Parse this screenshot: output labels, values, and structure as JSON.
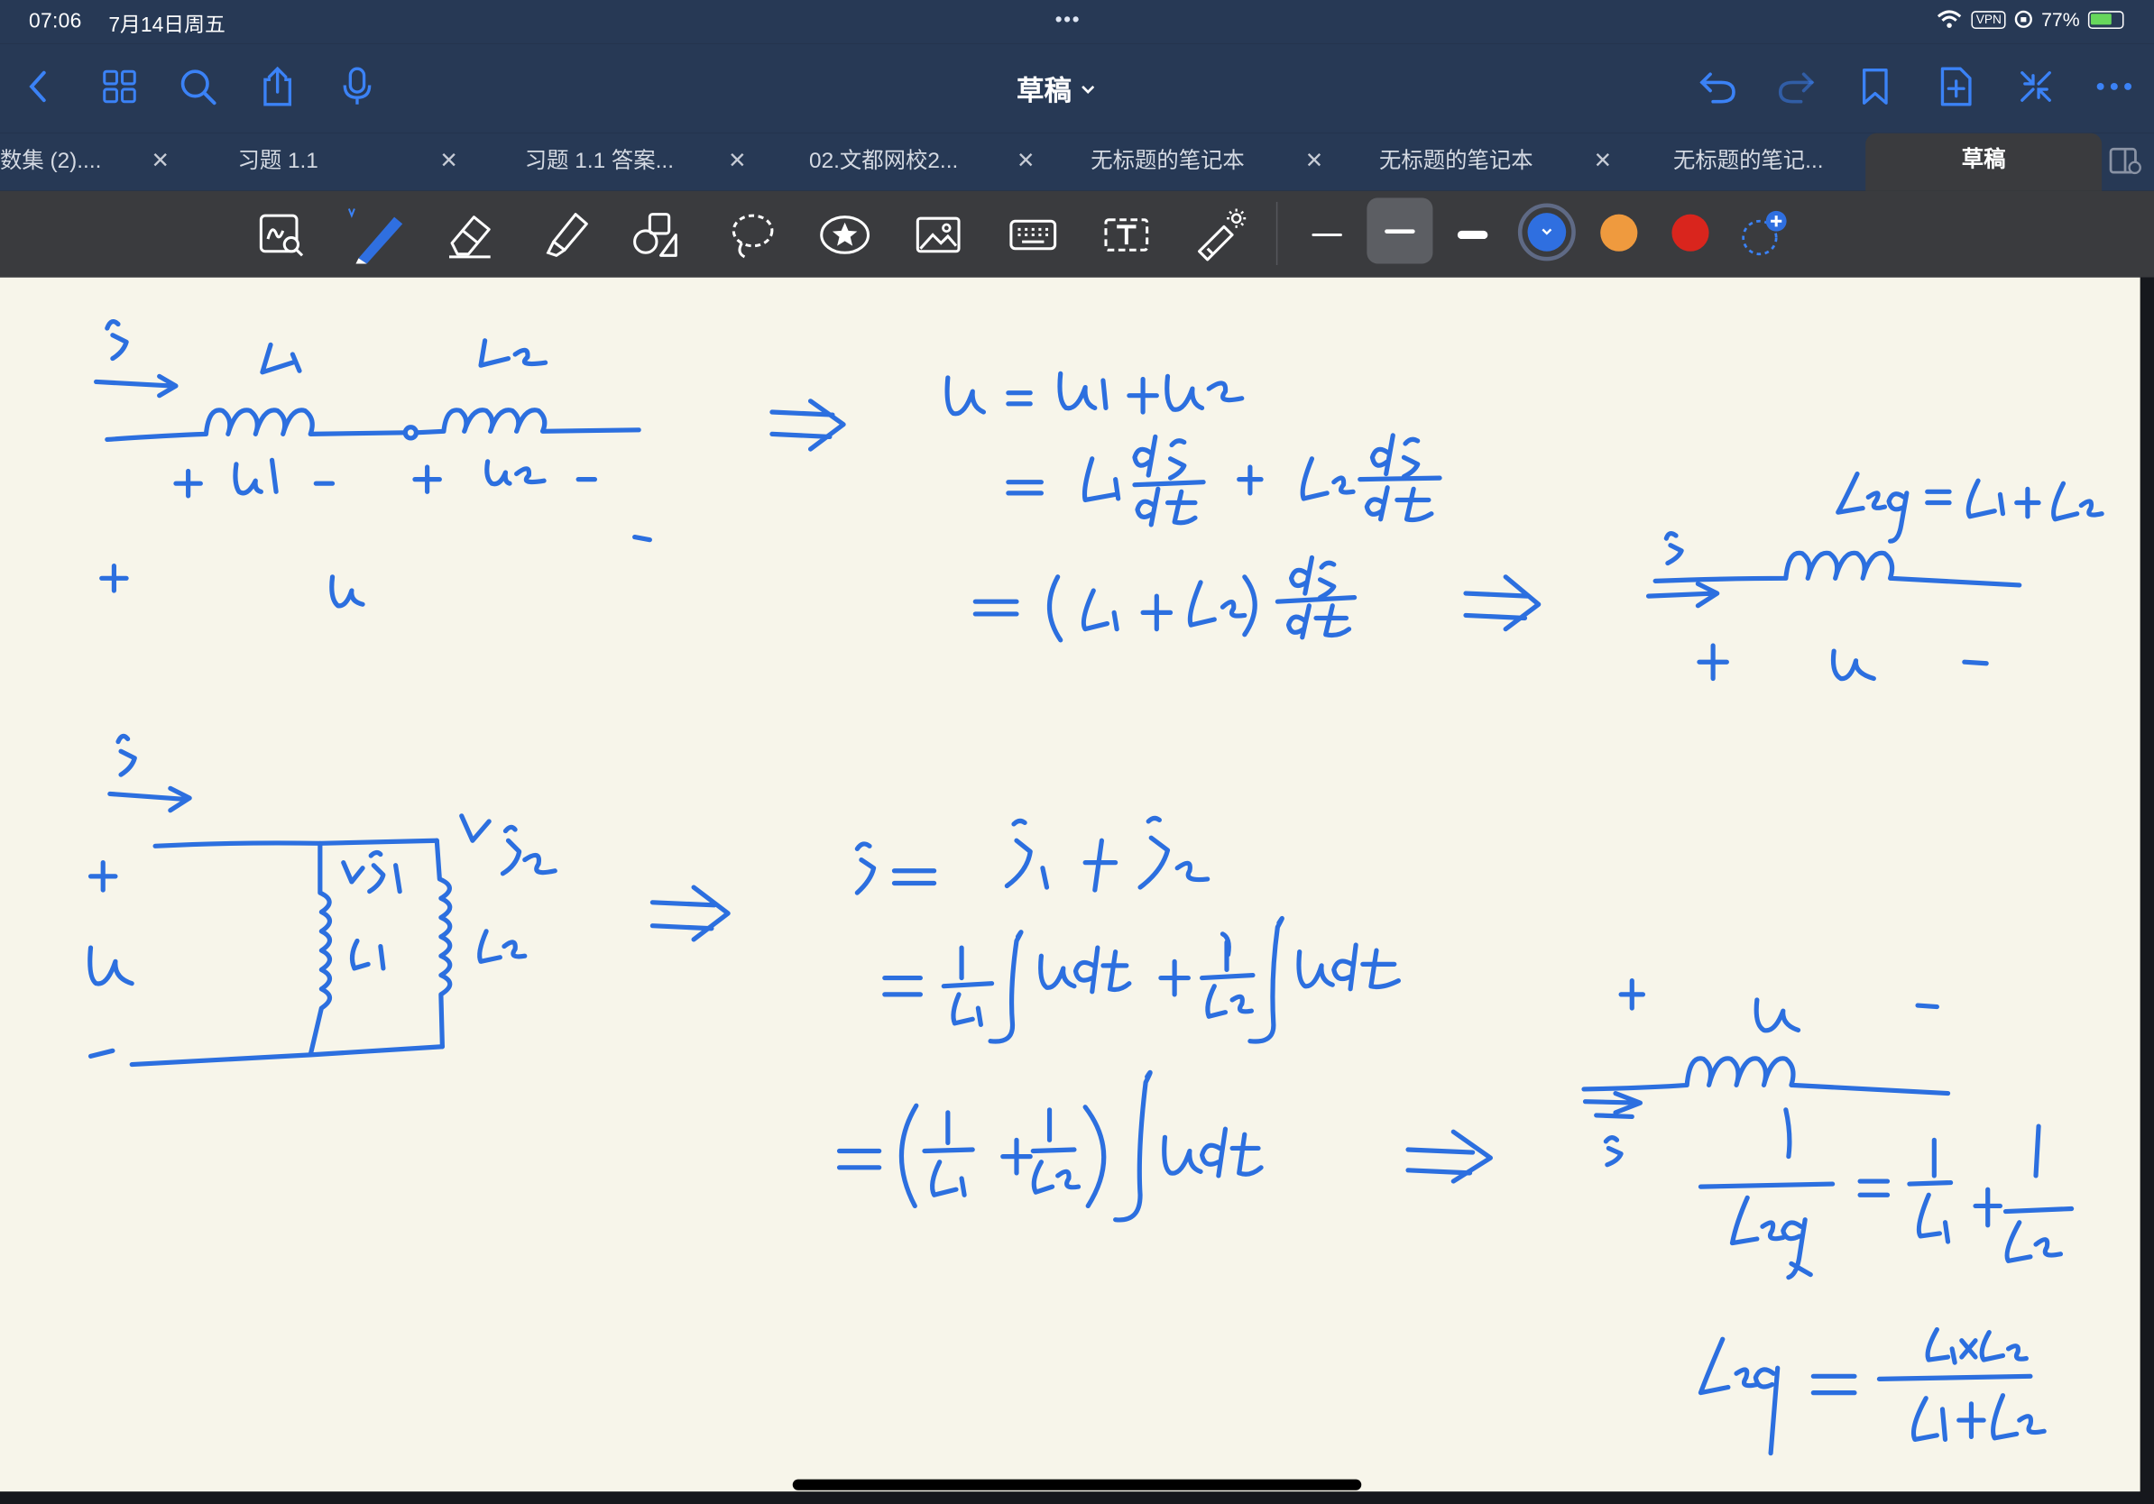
{
  "status_bar": {
    "time": "07:06",
    "date": "7月14日周五",
    "vpn": "VPN",
    "battery": "77%",
    "battery_level": 0.77
  },
  "nav": {
    "title": "草稿",
    "left_icons": [
      "chevron-left-icon",
      "grid-icon",
      "search-icon",
      "share-icon",
      "microphone-icon"
    ],
    "right_icons": [
      "undo-icon",
      "redo-icon",
      "bookmark-icon",
      "add-page-icon",
      "collapse-icon",
      "more-icon"
    ]
  },
  "tabs": [
    {
      "label": "数集 (2)...."
    },
    {
      "label": "习题 1.1"
    },
    {
      "label": "习题 1.1 答案..."
    },
    {
      "label": "02.文都网校2..."
    },
    {
      "label": "无标题的笔记本"
    },
    {
      "label": "无标题的笔记本"
    },
    {
      "label": "无标题的笔记..."
    },
    {
      "label": "草稿",
      "active": true
    }
  ],
  "toolbar": {
    "tools": [
      "zoom-box-icon",
      "pen-icon",
      "eraser-icon",
      "highlighter-icon",
      "shapes-icon",
      "lasso-icon",
      "sticker-icon",
      "image-icon",
      "keyboard-icon",
      "text-icon",
      "laser-pointer-icon"
    ],
    "active_tool": "pen-icon",
    "stroke_sizes": [
      "thin",
      "medium",
      "thick"
    ],
    "active_stroke": "medium",
    "colors": [
      "#2f6fe0",
      "#ef9a3e",
      "#d9251d"
    ],
    "active_color": "#2f6fe0"
  },
  "canvas": {
    "background": "#f7f5ea",
    "ink_color": "#2c6fdf"
  }
}
